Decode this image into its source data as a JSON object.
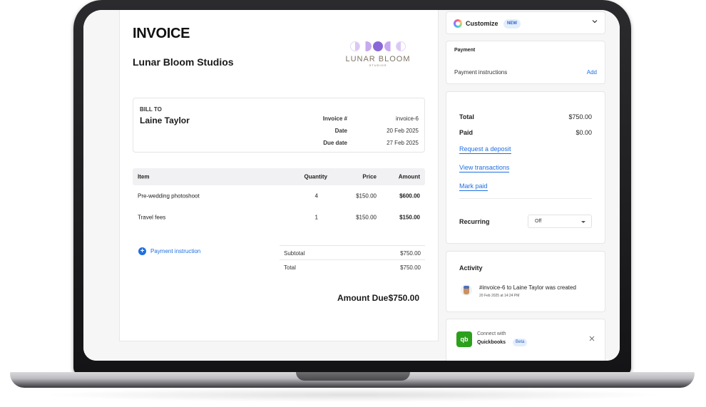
{
  "invoice": {
    "title": "INVOICE",
    "business_name": "Lunar Bloom Studios",
    "logo": {
      "name": "LUNAR BLOOM",
      "sub": "STUDIOS"
    },
    "bill_to": {
      "label": "BILL TO",
      "name": "Laine Taylor",
      "meta": [
        {
          "label": "Invoice #",
          "value": "invoice-6"
        },
        {
          "label": "Date",
          "value": "20 Feb 2025"
        },
        {
          "label": "Due date",
          "value": "27 Feb 2025"
        }
      ]
    },
    "table": {
      "headers": {
        "item": "Item",
        "quantity": "Quantity",
        "price": "Price",
        "amount": "Amount"
      },
      "rows": [
        {
          "item": "Pre-wedding photoshoot",
          "quantity": "4",
          "price": "$150.00",
          "amount": "$600.00"
        },
        {
          "item": "Travel fees",
          "quantity": "1",
          "price": "$150.00",
          "amount": "$150.00"
        }
      ]
    },
    "payment_instruction_label": "Payment instruction",
    "totals": [
      {
        "label": "Subtotal",
        "value": "$750.00"
      },
      {
        "label": "Total",
        "value": "$750.00"
      }
    ],
    "amount_due": {
      "label": "Amount Due",
      "value": "$750.00"
    }
  },
  "sidebar": {
    "customize": {
      "label": "Customize",
      "badge": "NEW"
    },
    "payment": {
      "title": "Payment",
      "instructions_label": "Payment instructions",
      "add_label": "Add"
    },
    "summary": {
      "total": {
        "label": "Total",
        "value": "$750.00"
      },
      "paid": {
        "label": "Paid",
        "value": "$0.00"
      },
      "links": [
        "Request a deposit",
        "View transactions",
        "Mark paid"
      ],
      "recurring": {
        "label": "Recurring",
        "value": "Off"
      }
    },
    "activity": {
      "title": "Activity",
      "items": [
        {
          "text": "#invoice-6 to Laine Taylor was created",
          "time": "20 Feb 2025 at 14:24 PM"
        }
      ]
    },
    "quickbooks": {
      "connect_label": "Connect with",
      "name": "Quickbooks",
      "badge": "Beta",
      "icon_text": "qb"
    }
  },
  "colors": {
    "accent": "#1f6fe0",
    "quickbooks": "#2ca01c",
    "badge_bg": "#e3edfc"
  }
}
